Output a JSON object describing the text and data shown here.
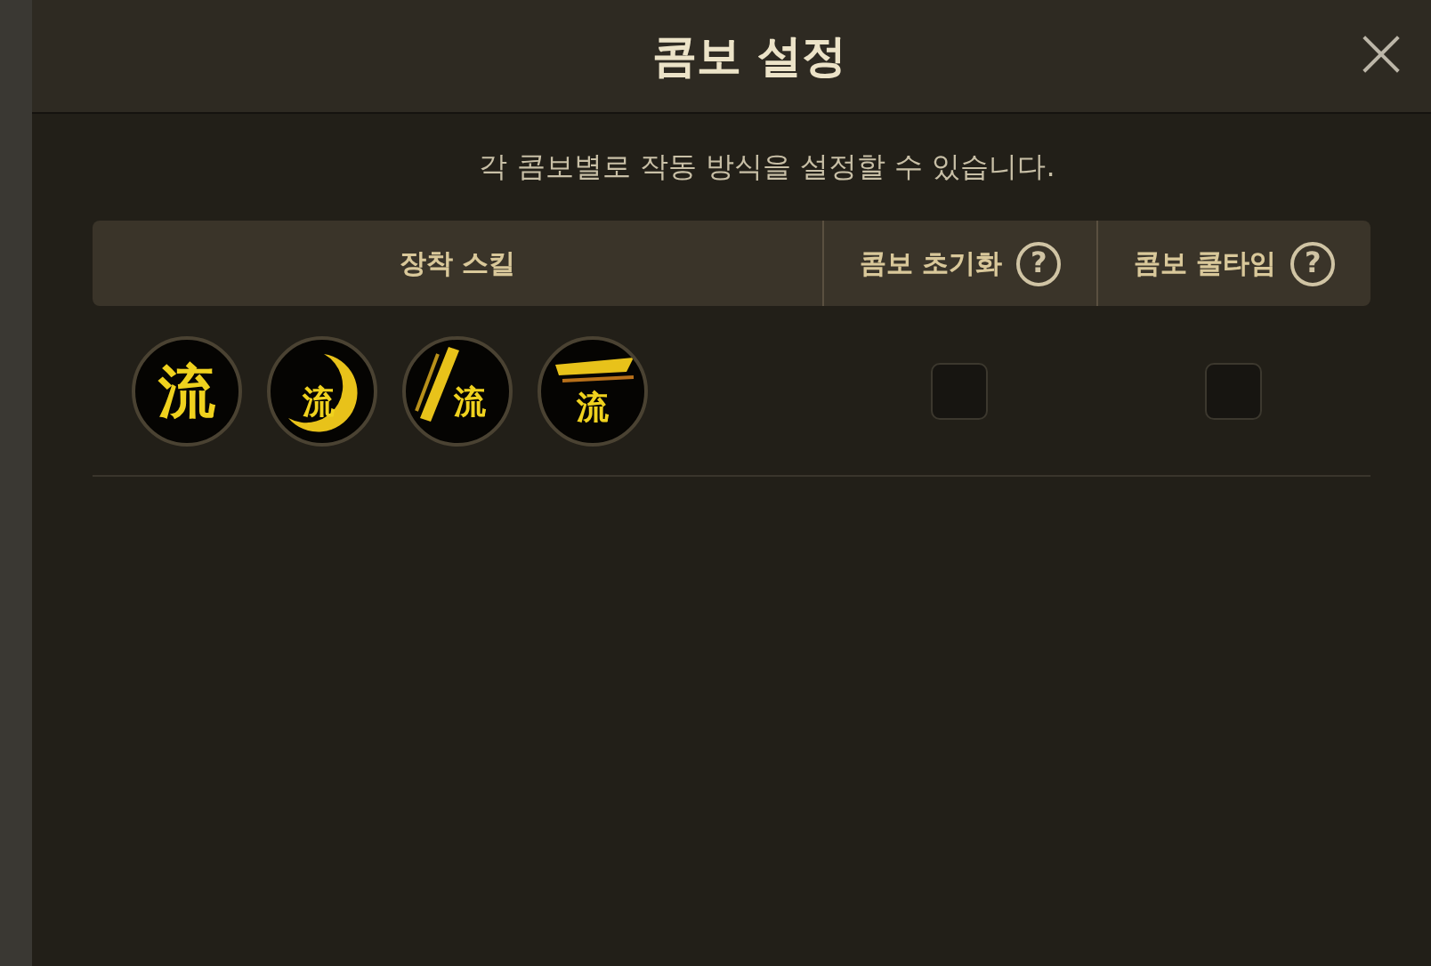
{
  "dialog": {
    "title": "콤보 설정",
    "close": "×",
    "description": "각 콤보별로 작동 방식을 설정할 수 있습니다."
  },
  "table": {
    "columns": [
      {
        "label": "장착 스킬"
      },
      {
        "label": "콤보 초기화",
        "help": "?"
      },
      {
        "label": "콤보 쿨타임",
        "help": "?"
      }
    ],
    "rows": [
      {
        "skills": [
          {
            "kind": "plain",
            "glyph": "流"
          },
          {
            "kind": "crescent",
            "glyph": "流"
          },
          {
            "kind": "slash",
            "glyph": "流"
          },
          {
            "kind": "wing",
            "glyph": "流"
          }
        ],
        "reset": {
          "checked": false
        },
        "cooldown": {
          "checked": false
        }
      }
    ]
  }
}
